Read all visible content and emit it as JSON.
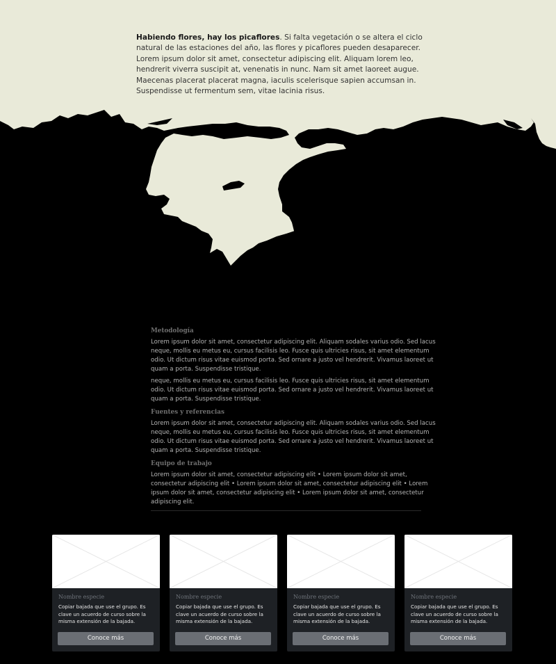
{
  "intro": {
    "bold": "Habiendo flores, hay los picaflores",
    "text": ". Si falta vegetación o se altera el ciclo natural de las estaciones del año, las flores y picaflores pueden desaparecer. Lorem ipsum dolor sit amet, consectetur adipiscing elit. Aliquam lorem leo, hendrerit viverra suscipit at, venenatis in nunc. Nam sit amet laoreet augue. Maecenas placerat placerat magna, iaculis scelerisque sapien accumsan in. Suspendisse ut fermentum sem, vitae lacinia risus."
  },
  "info": {
    "methodology": {
      "title": "Metodología",
      "p1": "Lorem ipsum dolor sit amet, consectetur adipiscing elit. Aliquam sodales varius odio. Sed lacus neque, mollis eu metus eu, cursus facilisis leo. Fusce quis ultricies risus, sit amet elementum odio. Ut dictum risus vitae euismod porta. Sed ornare a justo vel hendrerit. Vivamus laoreet ut quam a porta. Suspendisse tristique.",
      "p2": "neque, mollis eu metus eu, cursus facilisis leo. Fusce quis ultricies risus, sit amet elementum odio. Ut dictum risus vitae euismod porta. Sed ornare a justo vel hendrerit. Vivamus laoreet ut quam a porta. Suspendisse tristique."
    },
    "sources": {
      "title": "Fuentes y referencias",
      "p1": "Lorem ipsum dolor sit amet, consectetur adipiscing elit. Aliquam sodales varius odio. Sed lacus neque, mollis eu metus eu, cursus facilisis leo. Fusce quis ultricies risus, sit amet elementum odio. Ut dictum risus vitae euismod porta. Sed ornare a justo vel hendrerit. Vivamus laoreet ut quam a porta. Suspendisse tristique."
    },
    "team": {
      "title": "Equipo de trabajo",
      "p1": "Lorem ipsum dolor sit amet, consectetur adipiscing elit • Lorem ipsum dolor sit amet, consectetur adipiscing elit • Lorem ipsum dolor sit amet, consectetur adipiscing elit • Lorem ipsum dolor sit amet, consectetur adipiscing elit • Lorem ipsum dolor sit amet, consectetur adipiscing elit."
    }
  },
  "cards": [
    {
      "name": "Nombre especie",
      "desc": "Copiar bajada que use el grupo. Es clave un acuerdo de curso sobre la misma extensión de la bajada.",
      "button": "Conoce más"
    },
    {
      "name": "Nombre especie",
      "desc": "Copiar bajada que use el grupo. Es clave un acuerdo de curso sobre la misma extensión de la bajada.",
      "button": "Conoce más"
    },
    {
      "name": "Nombre especie",
      "desc": "Copiar bajada que use el grupo. Es clave un acuerdo de curso sobre la misma extensión de la bajada.",
      "button": "Conoce más"
    },
    {
      "name": "Nombre especie",
      "desc": "Copiar bajada que use el grupo. Es clave un acuerdo de curso sobre la misma extensión de la bajada.",
      "button": "Conoce más"
    }
  ],
  "colors": {
    "cream": "#e9ead9",
    "black": "#000000",
    "card_bg": "#1e2125",
    "button": "#6a6e74"
  }
}
